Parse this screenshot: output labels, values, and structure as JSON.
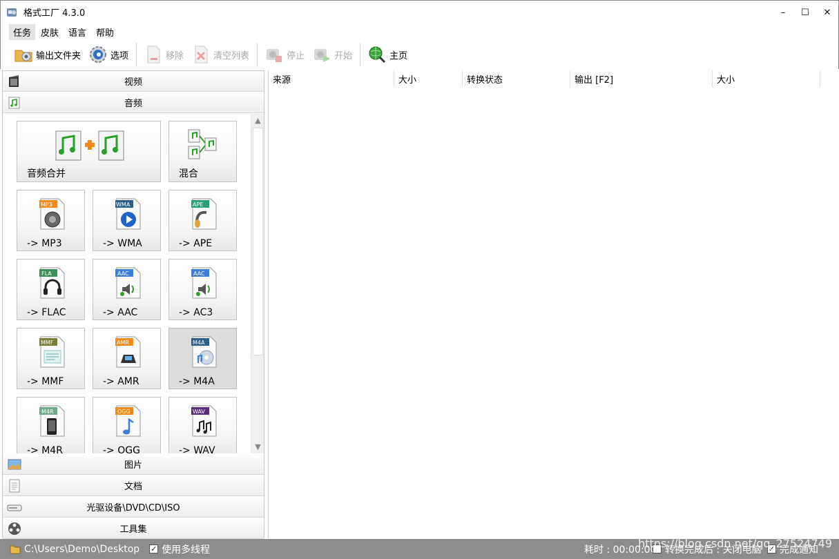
{
  "window": {
    "title": "格式工厂 4.3.0",
    "controls": [
      "–",
      "☐",
      "✕"
    ]
  },
  "menu": [
    "任务",
    "皮肤",
    "语言",
    "帮助"
  ],
  "toolbar": {
    "output_folder": "输出文件夹",
    "options": "选项",
    "remove": "移除",
    "clear_list": "清空列表",
    "stop": "停止",
    "start": "开始",
    "home": "主页"
  },
  "categories": {
    "video": "视频",
    "audio": "音频",
    "image": "图片",
    "document": "文档",
    "optical": "光驱设备\\DVD\\CD\\ISO",
    "tools": "工具集"
  },
  "tiles": {
    "merge": "音频合并",
    "mix": "混合",
    "mp3": "-> MP3",
    "wma": "-> WMA",
    "ape": "-> APE",
    "flac": "-> FLAC",
    "aac": "-> AAC",
    "ac3": "-> AC3",
    "mmf": "-> MMF",
    "amr": "-> AMR",
    "m4a": "-> M4A",
    "m4r": "-> M4R",
    "ogg": "-> OGG",
    "wav": "-> WAV"
  },
  "badges": {
    "mp3": "MP3",
    "wma": "WMA",
    "ape": "APE",
    "flac": "FLA",
    "aac": "AAC",
    "ac3": "AAC",
    "mmf": "MMF",
    "amr": "AMR",
    "m4a": "M4A",
    "m4r": "M4R",
    "ogg": "OGG",
    "wav": "WAV"
  },
  "list_columns": {
    "source": "来源",
    "size": "大小",
    "status": "转换状态",
    "output": "输出 [F2]",
    "size2": "大小"
  },
  "statusbar": {
    "path": "C:\\Users\\Demo\\Desktop",
    "multithread": "使用多线程",
    "elapsed": "耗时 : 00:00:00",
    "shutdown": "转换完成后 : 关闭电脑",
    "notify": "完成通知",
    "multithread_checked": true,
    "shutdown_checked": false,
    "notify_checked": true
  },
  "watermark": "https://blog.csdn.net/qq_27524749"
}
